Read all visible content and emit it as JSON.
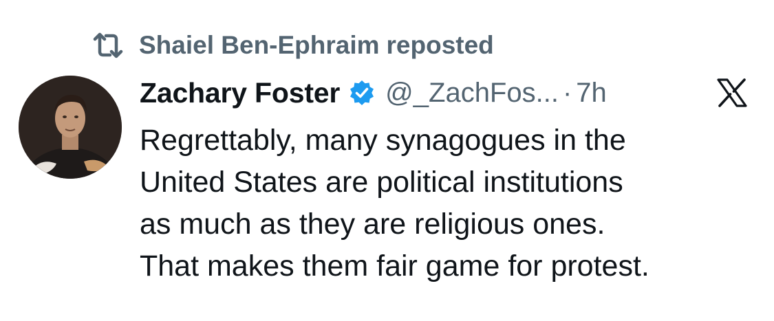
{
  "repost": {
    "icon": "repost-icon",
    "user": "Shaiel Ben-Ephraim",
    "label": "reposted"
  },
  "author": {
    "avatar": "avatar",
    "display_name": "Zachary Foster",
    "verified_icon": "verified-badge-icon",
    "handle": "@_ZachFos...",
    "separator": "·",
    "time": "7h"
  },
  "brand": {
    "logo": "x-logo-icon"
  },
  "tweet": {
    "lines": [
      "Regrettably, many synagogues in the",
      "United States are political institutions",
      "as much as they are religious ones.",
      "That makes them fair game for protest."
    ]
  },
  "colors": {
    "text_primary": "#0f1419",
    "text_secondary": "#536471",
    "verified_blue": "#1d9bf0",
    "background": "#ffffff"
  }
}
